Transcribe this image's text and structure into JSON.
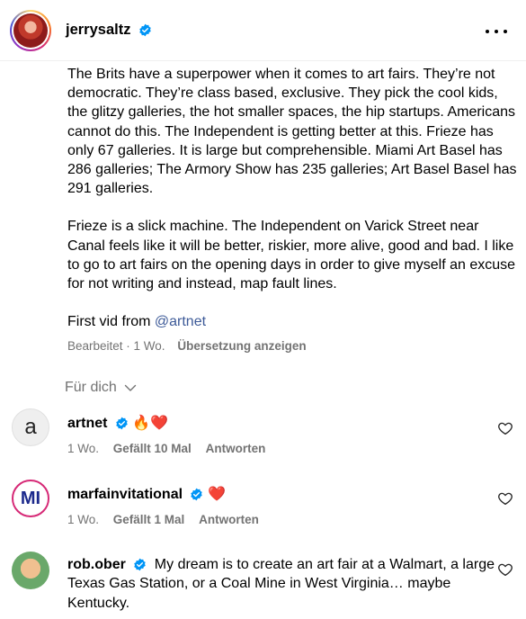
{
  "post": {
    "username": "jerrysaltz",
    "caption_p1": "The Brits have a superpower when it comes to art fairs. They’re not democratic. They’re class based, exclusive. They pick the cool kids, the glitzy galleries, the hot smaller spaces, the hip startups. Americans cannot do this. The Independent is getting better at this. Frieze has only 67 galleries. It is large but comprehensible. Miami Art Basel has 286 galleries; The Armory Show has 235 galleries; Art Basel Basel has 291 galleries.",
    "caption_p2": "Frieze is a slick machine. The Independent on Varick Street near Canal feels like it will be better, riskier, more alive, good and bad. I like to go to art fairs on the opening days in order to give myself an excuse for not writing and instead, map fault lines.",
    "caption_p3_prefix": "First vid from ",
    "caption_p3_mention": "@artnet",
    "edited": "Bearbeitet · 1 Wo.",
    "translate": "Übersetzung anzeigen"
  },
  "filter": {
    "label": "Für dich"
  },
  "comments": [
    {
      "username": "artnet",
      "text": "🔥❤️",
      "avatar_letter": "a",
      "time": "1 Wo.",
      "likes": "Gefällt 10 Mal",
      "reply": "Antworten"
    },
    {
      "username": "marfainvitational",
      "text": "❤️",
      "avatar_letter": "MI",
      "time": "1 Wo.",
      "likes": "Gefällt 1 Mal",
      "reply": "Antworten"
    },
    {
      "username": "rob.ober",
      "text": "My dream is to create an art fair at a Walmart, a large Texas Gas Station, or a Coal Mine in West Virginia… maybe Kentucky."
    }
  ],
  "colors": {
    "verified": "#0095f6",
    "muted": "#737373",
    "mention": "#3d5a98"
  }
}
